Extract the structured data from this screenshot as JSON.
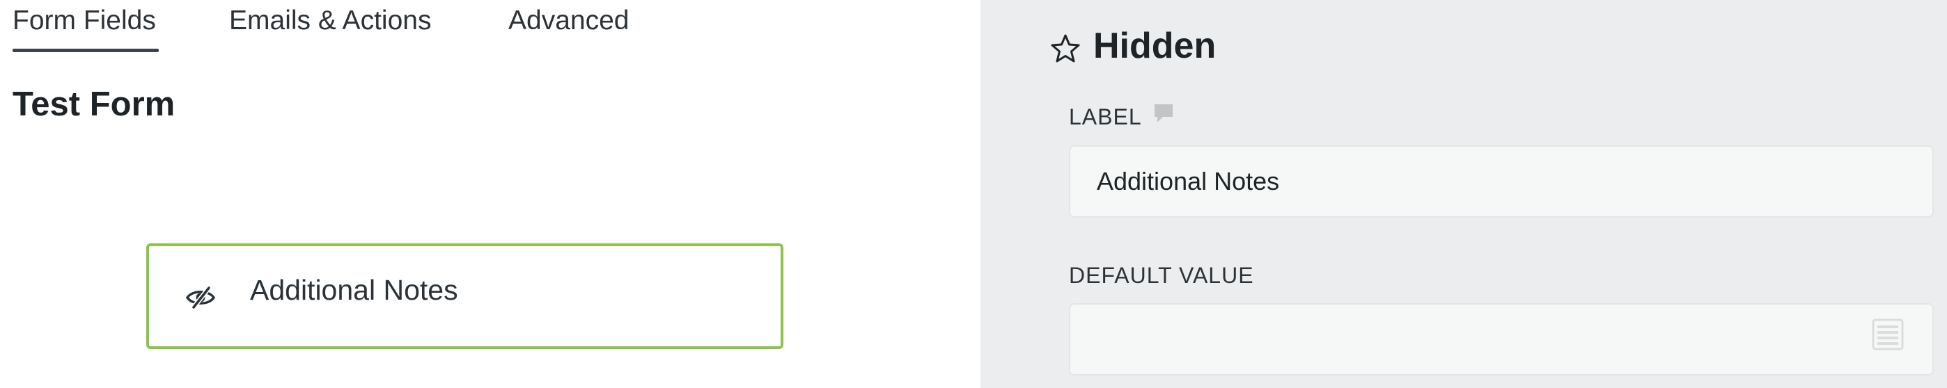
{
  "tabs": [
    {
      "label": "Form Fields",
      "active": true
    },
    {
      "label": "Emails & Actions",
      "active": false
    },
    {
      "label": "Advanced",
      "active": false
    }
  ],
  "form": {
    "title": "Test Form",
    "field": {
      "label": "Additional Notes",
      "icon": "eye-slash-icon",
      "border_color": "#8ac449"
    }
  },
  "panel": {
    "title": "Hidden",
    "title_icon": "star-outline-icon",
    "label_section": {
      "label": "LABEL",
      "icon": "comment-icon",
      "value": "Additional Notes"
    },
    "default_value_section": {
      "label": "DEFAULT VALUE",
      "value": "",
      "icon": "list-icon"
    }
  },
  "colors": {
    "accent": "#8ac449",
    "panel_bg": "#ecedef",
    "input_bg": "#f6f7f7"
  }
}
